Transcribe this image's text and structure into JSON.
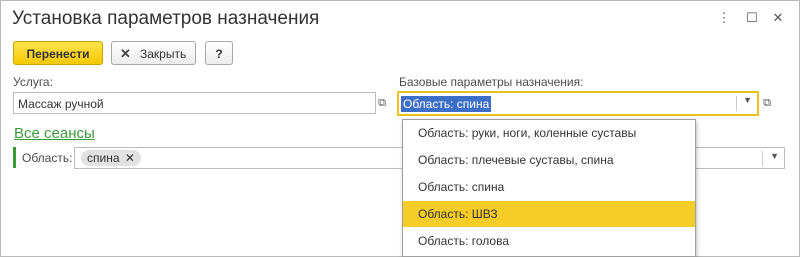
{
  "window": {
    "title": "Установка параметров назначения"
  },
  "toolbar": {
    "transfer_label": "Перенести",
    "close_label": "Закрыть",
    "help_label": "?"
  },
  "service": {
    "label": "Услуга:",
    "value": "Массаж ручной"
  },
  "base_params": {
    "label": "Базовые параметры назначения:",
    "value": "Область: спина"
  },
  "sessions": {
    "link_label": "Все сеансы",
    "area_label": "Область:",
    "area_tag": "спина"
  },
  "dropdown": {
    "options": [
      "Область: руки, ноги, коленные суставы",
      "Область: плечевые суставы, спина",
      "Область: спина",
      "Область: ШВЗ",
      "Область: голова"
    ],
    "selected_index": 3
  },
  "colors": {
    "accent": "#f6cd26",
    "link": "#3a9a3a",
    "focus_border": "#e9c21b",
    "selection": "#3c70c8"
  }
}
